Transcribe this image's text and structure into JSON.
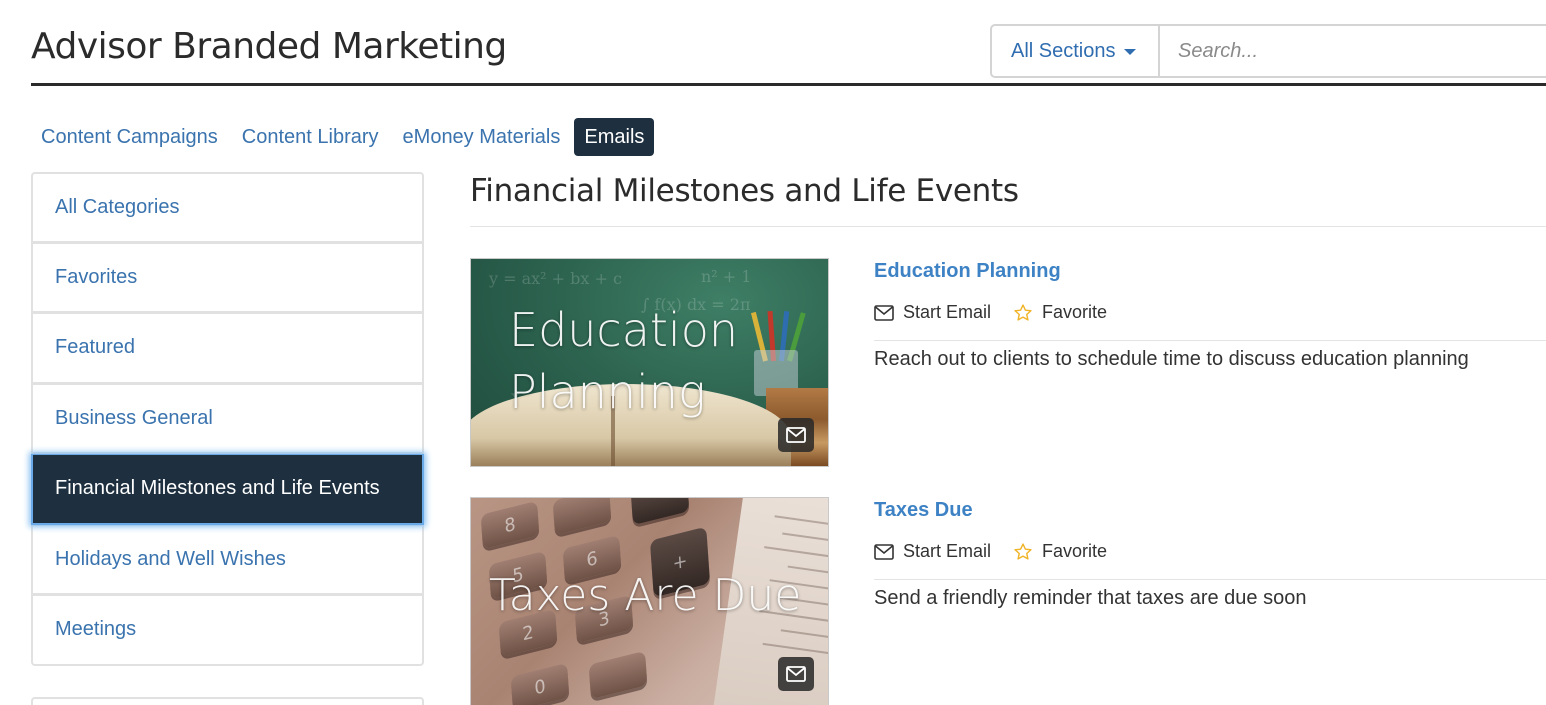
{
  "header": {
    "app_title": "Advisor Branded Marketing",
    "section_select": "All Sections",
    "search_placeholder": "Search..."
  },
  "tabs": [
    {
      "label": "Content Campaigns",
      "active": false
    },
    {
      "label": "Content Library",
      "active": false
    },
    {
      "label": "eMoney Materials",
      "active": false
    },
    {
      "label": "Emails",
      "active": true
    }
  ],
  "sidebar": {
    "categories": [
      {
        "label": "All Categories",
        "active": false
      },
      {
        "label": "Favorites",
        "active": false
      },
      {
        "label": "Featured",
        "active": false
      },
      {
        "label": "Business General",
        "active": false
      },
      {
        "label": "Financial Milestones and Life Events",
        "active": true
      },
      {
        "label": "Holidays and Well Wishes",
        "active": false
      },
      {
        "label": "Meetings",
        "active": false
      }
    ]
  },
  "main": {
    "title": "Financial Milestones and Life Events",
    "items": [
      {
        "title": "Education Planning",
        "thumb_line1": "Education",
        "thumb_line2": "Planning",
        "start_email_label": "Start Email",
        "favorite_label": "Favorite",
        "description": "Reach out to clients to schedule time to discuss education planning"
      },
      {
        "title": "Taxes Due",
        "thumb_line1": "Taxes Are Due",
        "start_email_label": "Start Email",
        "favorite_label": "Favorite",
        "description": "Send a friendly reminder that taxes are due soon"
      }
    ]
  },
  "colors": {
    "link": "#3a73ae",
    "item_title": "#3d82c4",
    "active_bg": "#1e3040",
    "star": "#f0b429"
  },
  "icons": [
    "caret-down-icon",
    "envelope-icon",
    "star-outline-icon"
  ]
}
